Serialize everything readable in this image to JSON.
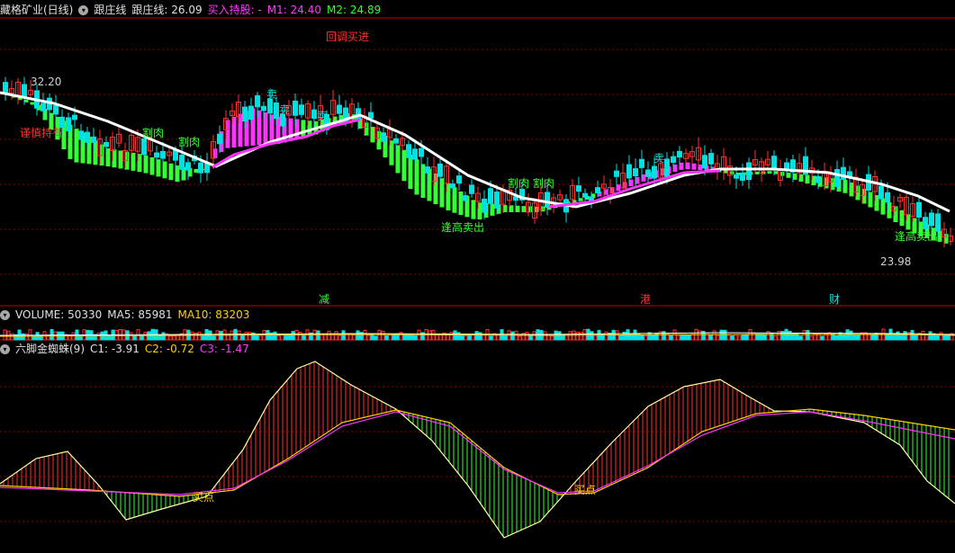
{
  "main_header": {
    "title": "藏格矿业(日线)",
    "indicator": "跟庄线",
    "line_label": "跟庄线: 26.09",
    "signal": "买入持股: -",
    "m1": "M1: 24.40",
    "m2": "M2: 24.89"
  },
  "volume_header": {
    "volume": "VOLUME: 50330",
    "ma5": "MA5: 85981",
    "ma10": "MA10: 83203"
  },
  "spider_header": {
    "name": "六脚金蜘蛛(9)",
    "c1": "C1: -3.91",
    "c2": "C2: -0.72",
    "c3": "C3: -1.47"
  },
  "colors": {
    "up": "#ff3030",
    "down": "#00e0e0",
    "ribbon_green": "#33ff33",
    "ribbon_magenta": "#ff33ff",
    "white_line": "#ffffff",
    "magenta_line": "#ff33ff",
    "grid": "#8b0000",
    "panel_border": "#c00000",
    "icon": "chevron-down-icon"
  },
  "chart_data": {
    "type": "candlestick",
    "price_high_label": "32.20",
    "price_low_label": "23.98",
    "annotations": [
      {
        "text": "回调买进",
        "color": "#ff3030"
      },
      {
        "text": "谨慎持有",
        "color": "#ff3030"
      },
      {
        "text": "割肉",
        "color": "#33ff33"
      },
      {
        "text": "割肉",
        "color": "#33ff33"
      },
      {
        "text": "卖",
        "color": "#00e0e0"
      },
      {
        "text": "卖",
        "color": "#00e0e0"
      },
      {
        "text": "卖",
        "color": "#00e0e0"
      },
      {
        "text": "逢高卖出",
        "color": "#33ff33"
      },
      {
        "text": "割肉 割肉",
        "color": "#33ff33"
      },
      {
        "text": "卖",
        "color": "#00e0e0"
      },
      {
        "text": "逢高卖出",
        "color": "#33ff33"
      }
    ],
    "event_markers": [
      {
        "text": "减",
        "color": "#33ff33"
      },
      {
        "text": "港",
        "color": "#ff3030"
      },
      {
        "text": "财",
        "color": "#00e0e0"
      }
    ],
    "spider_markers": [
      {
        "text": "买点",
        "color": "#ffd000"
      },
      {
        "text": "买点",
        "color": "#ffd000"
      }
    ]
  }
}
